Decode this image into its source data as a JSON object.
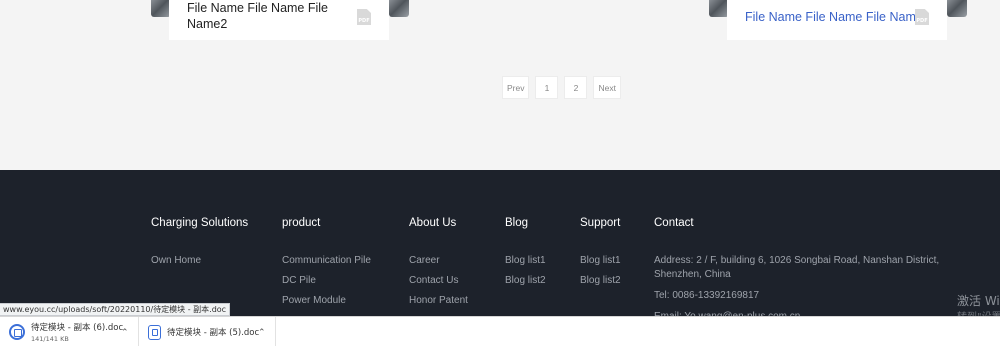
{
  "files": {
    "left_name": "File Name File Name File Name2",
    "right_name": "File Name File Name File Name",
    "pdf_label": "PDF"
  },
  "pagination": {
    "prev": "Prev",
    "page1": "1",
    "page2": "2",
    "next": "Next"
  },
  "footer": {
    "columns": [
      {
        "heading": "Charging Solutions",
        "links": [
          "Own Home"
        ]
      },
      {
        "heading": "product",
        "links": [
          "Communication Pile",
          "DC Pile",
          "Power Module"
        ]
      },
      {
        "heading": "About Us",
        "links": [
          "Career",
          "Contact Us",
          "Honor Patent"
        ]
      },
      {
        "heading": "Blog",
        "links": [
          "Blog list1",
          "Blog list2"
        ]
      },
      {
        "heading": "Support",
        "links": [
          "Blog list1",
          "Blog list2"
        ]
      },
      {
        "heading": "Contact",
        "links": [
          "Address: 2 / F, building 6, 1026 Songbai Road, Nanshan District, Shenzhen, China",
          "Tel: 0086-13392169817",
          "Email: Yo.wang@en-plus.com.cn"
        ]
      }
    ],
    "watermark": "激活 Wi",
    "watermark2": "转到\"设置\""
  },
  "status_url": "www.eyou.cc/uploads/soft/20220110/待定模块 - 副本.doc",
  "downloads": [
    {
      "name": "待定模块 - 副本 (6).doc",
      "size": "141/141 KB"
    },
    {
      "name": "待定模块 - 副本 (5).doc",
      "size": ""
    }
  ],
  "colors": {
    "page_bg": "#f4f4f4",
    "footer_bg": "#1d222b",
    "link_blue": "#3a62c8",
    "download_icon": "#3b6fd8"
  }
}
